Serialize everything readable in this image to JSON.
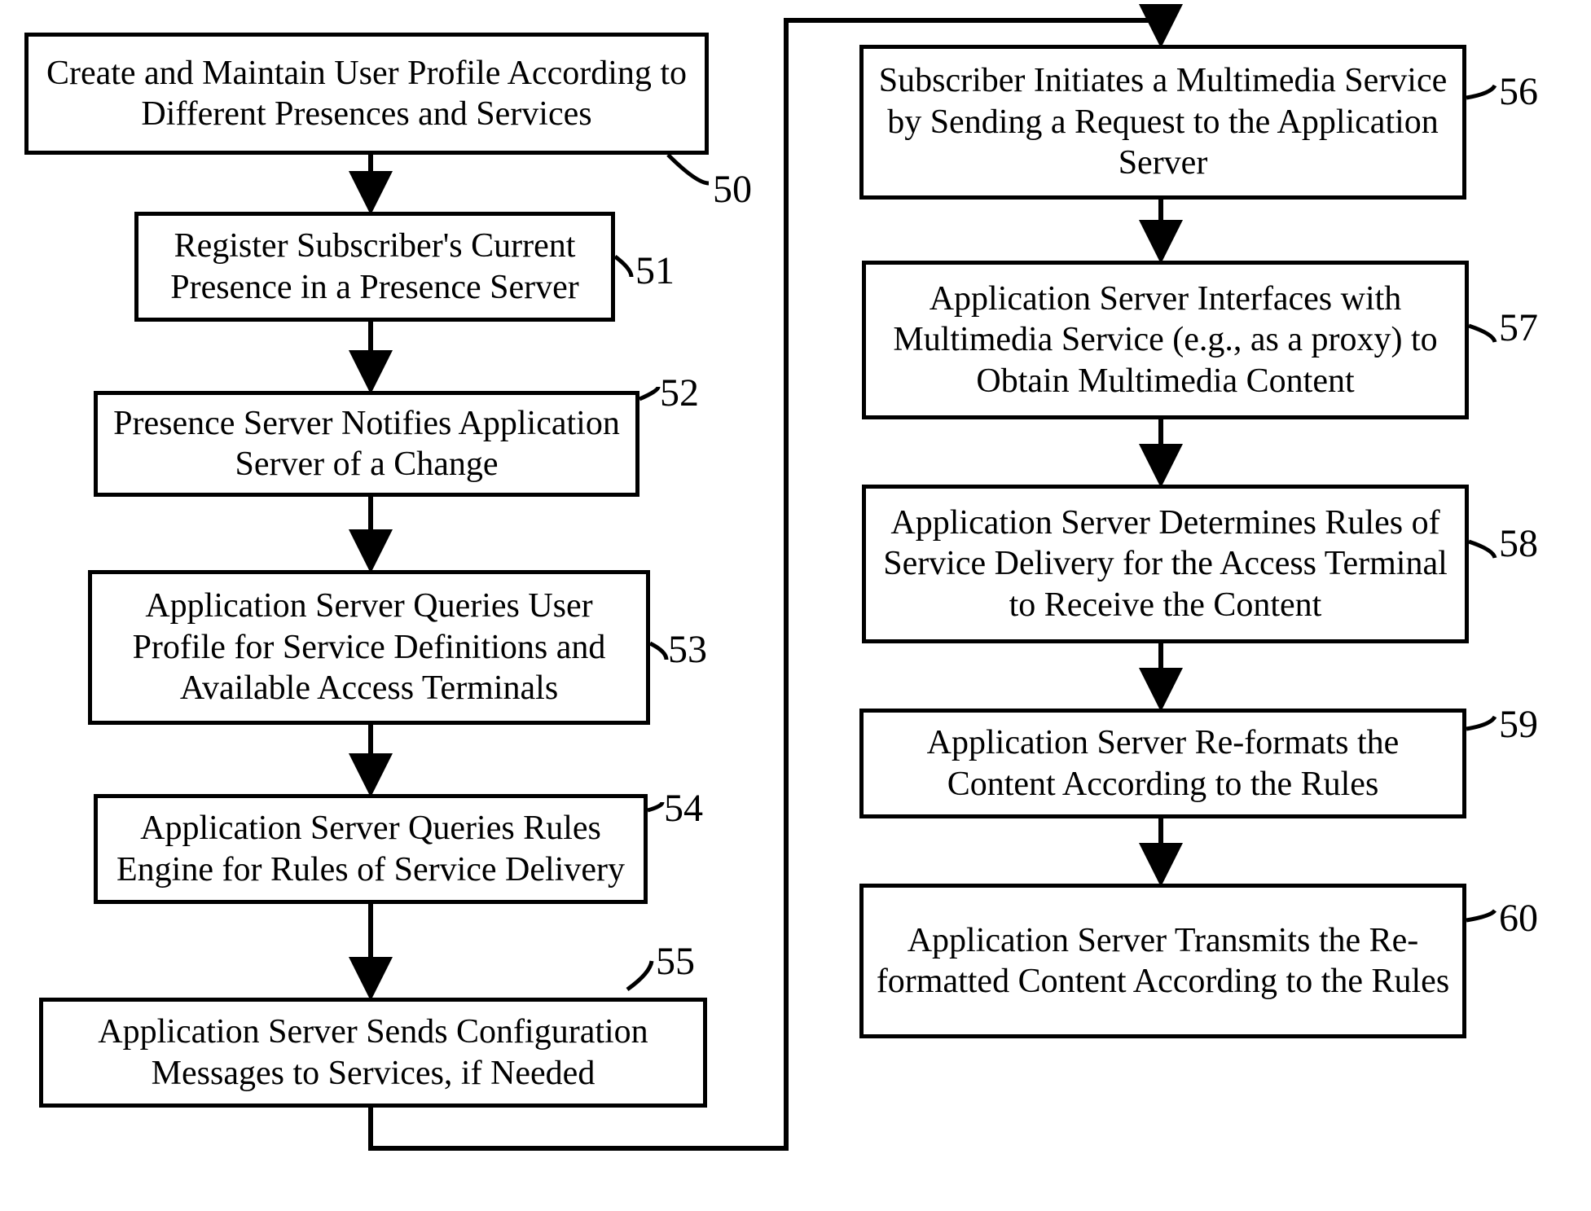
{
  "boxes": {
    "b50": "Create and Maintain User Profile According to Different Presences and Services",
    "b51": "Register Subscriber's Current Presence in a Presence Server",
    "b52": "Presence Server Notifies Application Server of a Change",
    "b53": "Application Server Queries User Profile for Service Definitions and Available Access Terminals",
    "b54": "Application Server Queries Rules Engine for Rules of Service Delivery",
    "b55": "Application Server Sends Configuration Messages to Services, if Needed",
    "b56": "Subscriber Initiates a Multimedia Service by Sending a Request to the Application Server",
    "b57": "Application Server Interfaces with Multimedia Service (e.g., as a proxy) to Obtain Multimedia Content",
    "b58": "Application Server Determines Rules of Service Delivery for the Access Terminal to Receive the Content",
    "b59": "Application Server Re-formats the Content According to the Rules",
    "b60": "Application Server Transmits the Re- formatted Content According to the Rules"
  },
  "labels": {
    "l50": "50",
    "l51": "51",
    "l52": "52",
    "l53": "53",
    "l54": "54",
    "l55": "55",
    "l56": "56",
    "l57": "57",
    "l58": "58",
    "l59": "59",
    "l60": "60"
  }
}
